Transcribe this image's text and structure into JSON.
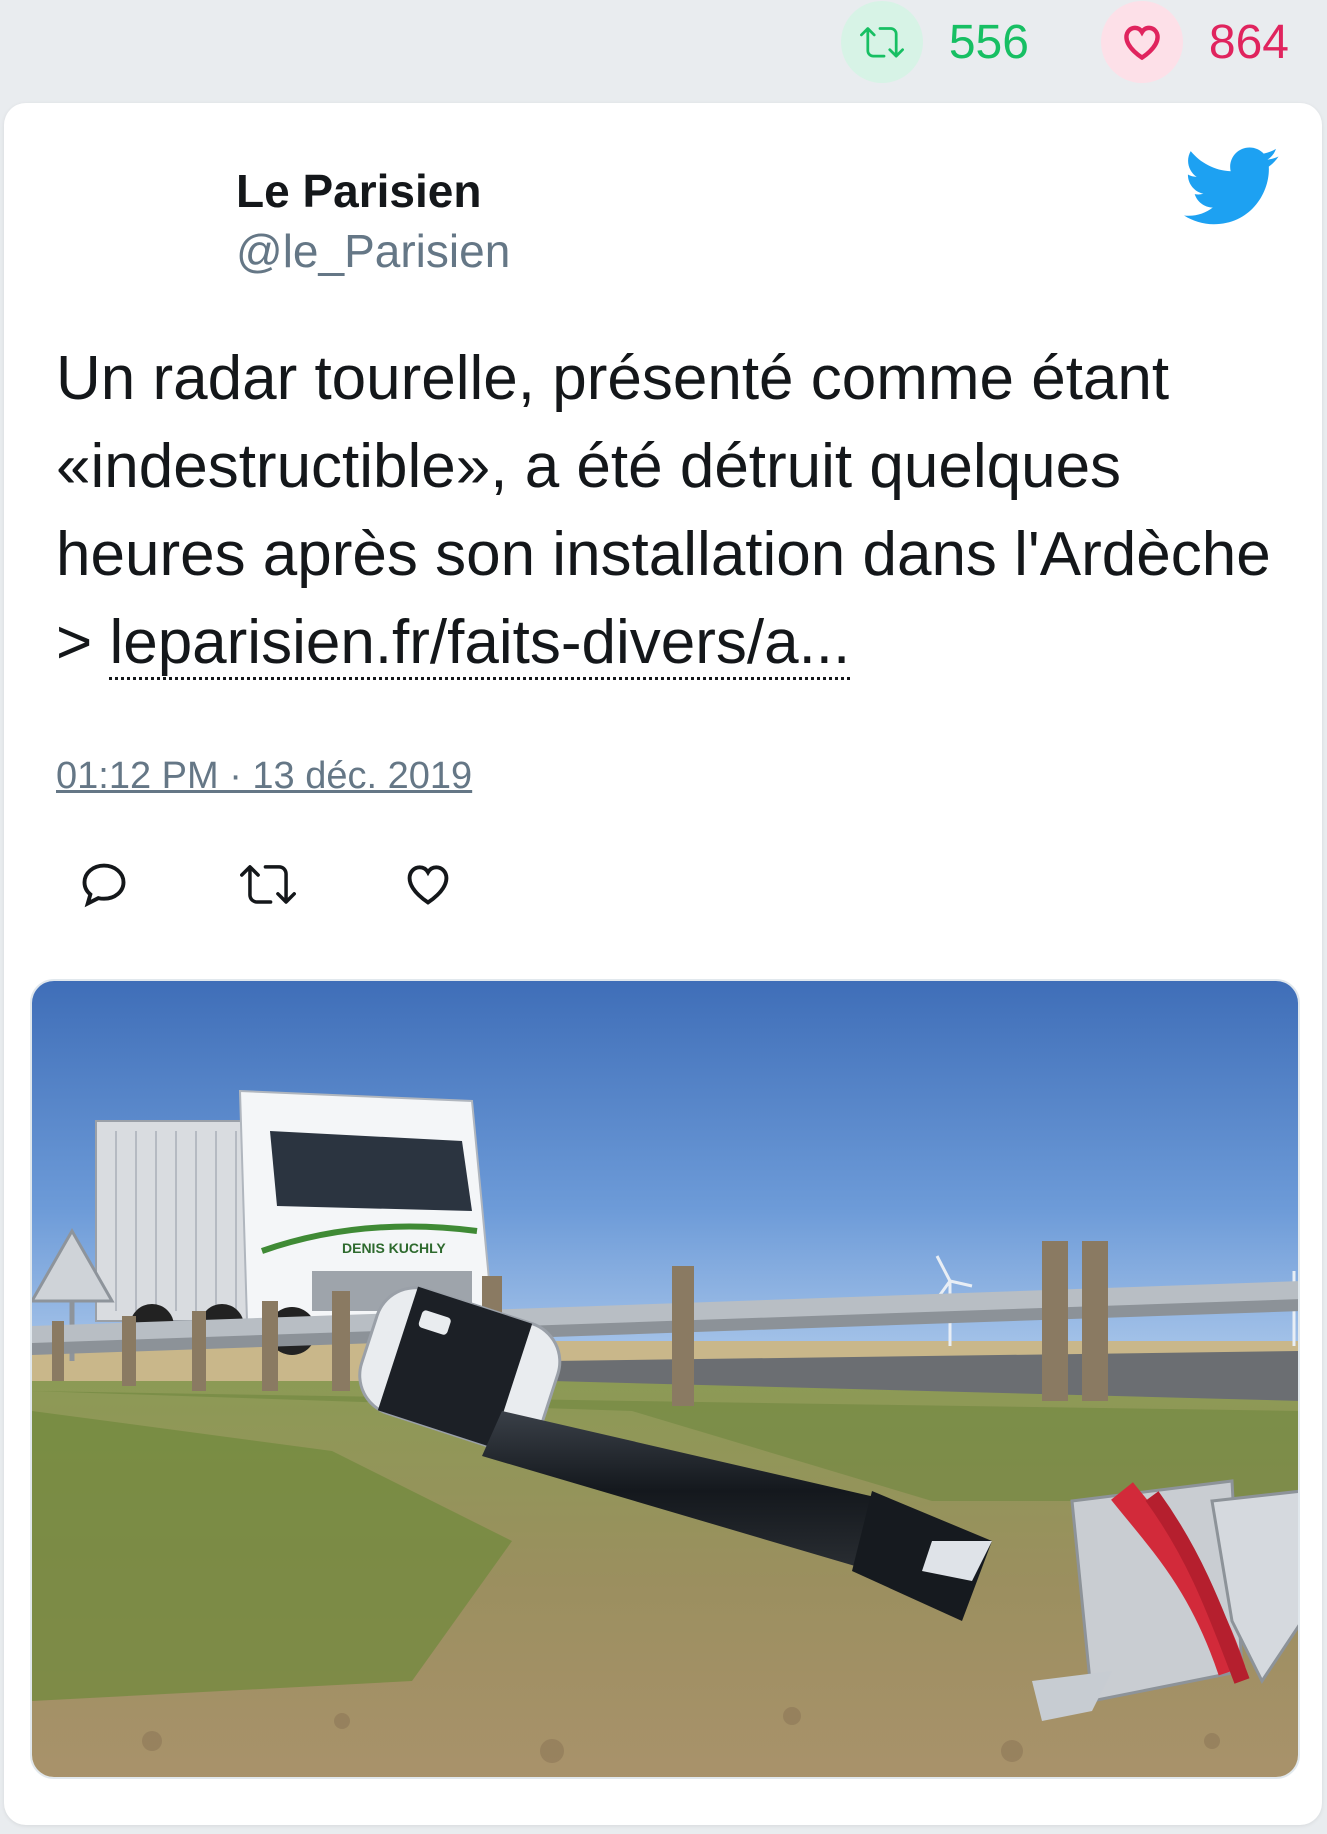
{
  "stats": {
    "retweet_icon": "retweet-icon",
    "retweet_count": "556",
    "like_icon": "heart-icon",
    "like_count": "864"
  },
  "tweet": {
    "author_name": "Le Parisien",
    "author_handle": "@le_Parisien",
    "text_before_link": "Un radar tourelle, présenté comme étant «indestructible», a été détruit quelques heures après son installation dans l'Ardèche > ",
    "link_text": "leparisien.fr/faits-divers/a...",
    "timestamp": "01:12 PM · 13 déc. 2019",
    "brand_icon": "twitter-bird-icon",
    "media_label": "DENIS KUCHLY"
  },
  "actions": [
    {
      "icon": "reply-icon"
    },
    {
      "icon": "retweet-icon"
    },
    {
      "icon": "like-icon"
    }
  ],
  "colors": {
    "background": "#e9ecef",
    "retweet_green": "#17bf63",
    "like_red": "#e0245e",
    "twitter_blue": "#1da1f2",
    "secondary_text": "#657786"
  }
}
